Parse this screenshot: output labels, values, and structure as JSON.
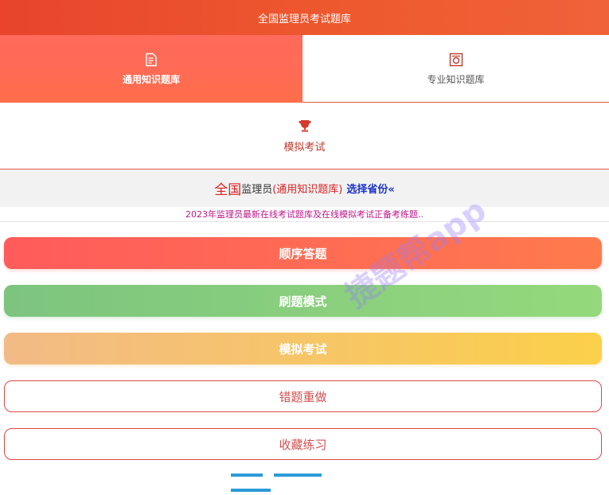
{
  "header": {
    "title": "全国监理员考试题库"
  },
  "tabs": [
    {
      "label": "通用知识题库",
      "icon": "document-edit-icon"
    },
    {
      "label": "专业知识题库",
      "icon": "cabinet-icon"
    }
  ],
  "mock_tab": {
    "label": "模拟考试",
    "icon": "trophy-icon"
  },
  "banner": {
    "region": "全国",
    "role": "监理员",
    "bank": "(通用知识题库)",
    "select_label": "选择省份«"
  },
  "marquee": {
    "text": "2023年监理员最新在线考试题库及在线模拟考试正备考练题.."
  },
  "buttons": {
    "sequential": "顺序答题",
    "practice_mode": "刷题模式",
    "mock_exam": "模拟考试",
    "wrong_redo": "错题重做",
    "favorites": "收藏练习"
  },
  "watermark": {
    "text": "捷题帮app"
  },
  "colors": {
    "brand_red": "#e8452c",
    "select_blue": "#1a33c8",
    "marquee_magenta": "#c0148a"
  }
}
